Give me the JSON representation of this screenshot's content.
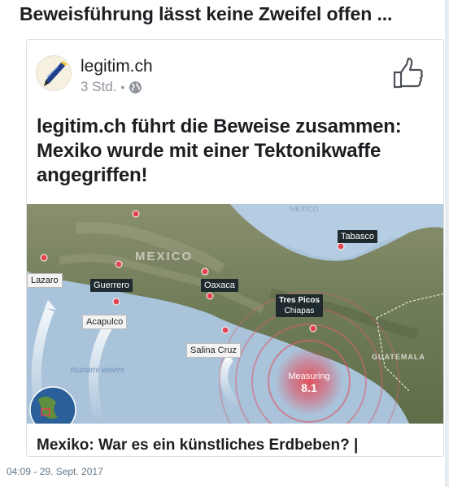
{
  "headline": "Beweisführung lässt keine Zweifel offen ...",
  "post": {
    "page_name": "legitim.ch",
    "time": "3 Std.",
    "separator": "•",
    "audience_icon": "globe-icon",
    "like_icon": "thumbs-up-icon",
    "text": "legitim.ch führt die Beweise zusammen: Mexiko wurde mit einer Tektonikwaffe angegriffen!",
    "link_title": "Mexiko: War es ein künstliches Erdbeben? |"
  },
  "map": {
    "labels": {
      "mexico_top": "MEXICO",
      "mexico": "MEXICO",
      "guatemala": "GUATEMALA",
      "lazaro": "Lazaro",
      "guerrero": "Guerrero",
      "oaxaca": "Oaxaca",
      "acapulco": "Acapulco",
      "salina_cruz": "Salina Cruz",
      "tabasco": "Tabasco",
      "tres_picos": "Tres Picos",
      "chiapas": "Chiapas",
      "tsunami": "tsunami waves",
      "measuring": "Measuring",
      "magnitude": "8.1"
    },
    "colors": {
      "ocean": "#a9c3da",
      "land": "#6f7d5a",
      "epicenter": "#e0414f"
    }
  },
  "timestamp": "04:09 - 29. Sept. 2017"
}
